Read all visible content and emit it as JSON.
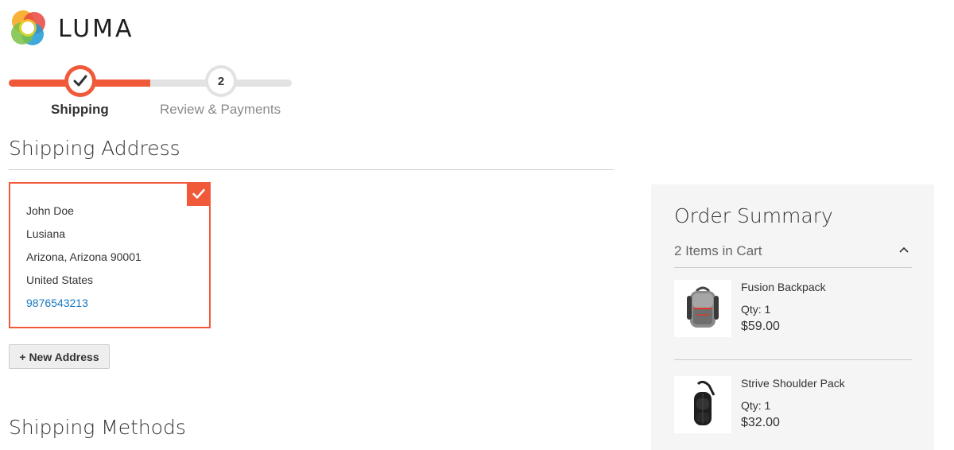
{
  "brand": {
    "name": "LUMA"
  },
  "progress": {
    "steps": [
      {
        "number": "",
        "label": "Shipping",
        "state": "complete"
      },
      {
        "number": "2",
        "label": "Review & Payments",
        "state": "pending"
      }
    ],
    "accent_color": "#f05a3a"
  },
  "shipping_address": {
    "title": "Shipping Address",
    "selected_address": {
      "name": "John Doe",
      "street": "Lusiana",
      "city_region_zip": "Arizona, Arizona 90001",
      "country": "United States",
      "phone": "9876543213"
    },
    "new_address_label": "+ New Address"
  },
  "shipping_methods": {
    "title": "Shipping Methods"
  },
  "order_summary": {
    "title": "Order Summary",
    "items_count_label": "2 Items in Cart",
    "items": [
      {
        "name": "Fusion Backpack",
        "qty": "Qty: 1",
        "price": "$59.00"
      },
      {
        "name": "Strive Shoulder Pack",
        "qty": "Qty: 1",
        "price": "$32.00"
      }
    ]
  }
}
